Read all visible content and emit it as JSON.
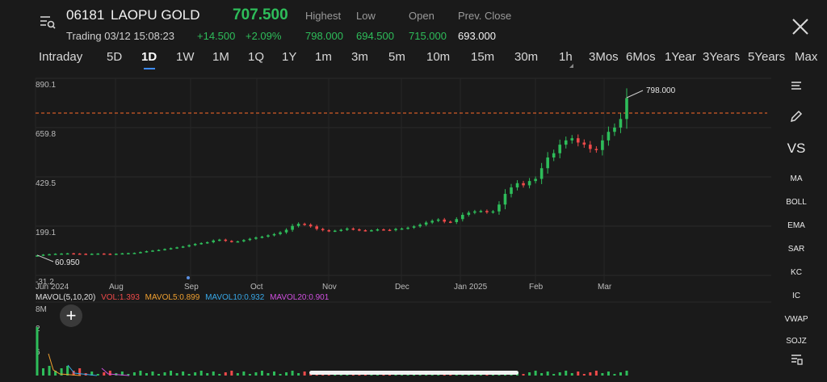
{
  "header": {
    "code": "06181",
    "name": "LAOPU GOLD",
    "price": "707.500",
    "status": "Trading 03/12 15:08:23",
    "change_abs": "+14.500",
    "change_pct": "+2.09%",
    "stats": [
      {
        "label": "Highest",
        "value": "798.000",
        "color": "#2ebd5a"
      },
      {
        "label": "Low",
        "value": "694.500",
        "color": "#2ebd5a"
      },
      {
        "label": "Open",
        "value": "715.000",
        "color": "#2ebd5a"
      },
      {
        "label": "Prev. Close",
        "value": "693.000",
        "color": "#f2f2f2"
      }
    ]
  },
  "tabs": [
    "Intraday",
    "5D",
    "1D",
    "1W",
    "1M",
    "1Q",
    "1Y",
    "1m",
    "3m",
    "5m",
    "10m",
    "15m",
    "30m",
    "1h",
    "3Mos",
    "6Mos",
    "1Year",
    "3Years",
    "5Years",
    "Max"
  ],
  "active_tab": "1D",
  "toolbar": {
    "items": [
      "VS",
      "MA",
      "BOLL",
      "EMA",
      "SAR",
      "KC",
      "IC",
      "VWAP",
      "SOJZ"
    ],
    "icons": [
      "list-icon",
      "pencil-icon",
      "layers-menu-icon"
    ]
  },
  "volume_legend": {
    "title": "MAVOL(5,10,20)",
    "vol": "VOL:1.393",
    "mavol5": "MAVOL5:0.899",
    "mavol10": "MAVOL10:0.932",
    "mavol20": "MAVOL20:0.901",
    "axis_labels": [
      "8M",
      "2",
      "6"
    ],
    "colors": {
      "vol": "#f04a4a",
      "mavol5": "#f0a030",
      "mavol10": "#38a8e8",
      "mavol20": "#d050e0",
      "title": "#e0e0e0"
    }
  },
  "colors": {
    "up": "#2ebd5a",
    "down": "#f04a4a",
    "prev_close_line": "#ff6a2a"
  },
  "chart_data": {
    "type": "candlestick",
    "y_ticks": [
      "890.1",
      "659.8",
      "429.5",
      "199.1",
      "-31.2"
    ],
    "ylim": [
      -31.2,
      890.1
    ],
    "x_ticks": [
      "Jun 2024",
      "Aug",
      "Sep",
      "Oct",
      "Nov",
      "Dec",
      "Jan 2025",
      "Feb",
      "Mar"
    ],
    "annotations": {
      "high": "798.000",
      "low": "60.950"
    },
    "reference_line": 693.0,
    "series_close": [
      62,
      66,
      68,
      70,
      71,
      72,
      71,
      70,
      69,
      70,
      71,
      70,
      69,
      70,
      72,
      73,
      74,
      78,
      82,
      85,
      88,
      92,
      96,
      100,
      104,
      110,
      116,
      120,
      124,
      132,
      136,
      130,
      126,
      128,
      134,
      140,
      146,
      150,
      156,
      162,
      170,
      182,
      200,
      210,
      206,
      198,
      186,
      180,
      176,
      178,
      182,
      188,
      184,
      180,
      178,
      180,
      184,
      182,
      180,
      186,
      188,
      192,
      198,
      206,
      216,
      224,
      230,
      220,
      218,
      232,
      252,
      262,
      268,
      270,
      264,
      268,
      300,
      350,
      380,
      400,
      390,
      410,
      420,
      470,
      520,
      540,
      580,
      600,
      610,
      590,
      580,
      560,
      555,
      600,
      640,
      660,
      700,
      798
    ]
  }
}
